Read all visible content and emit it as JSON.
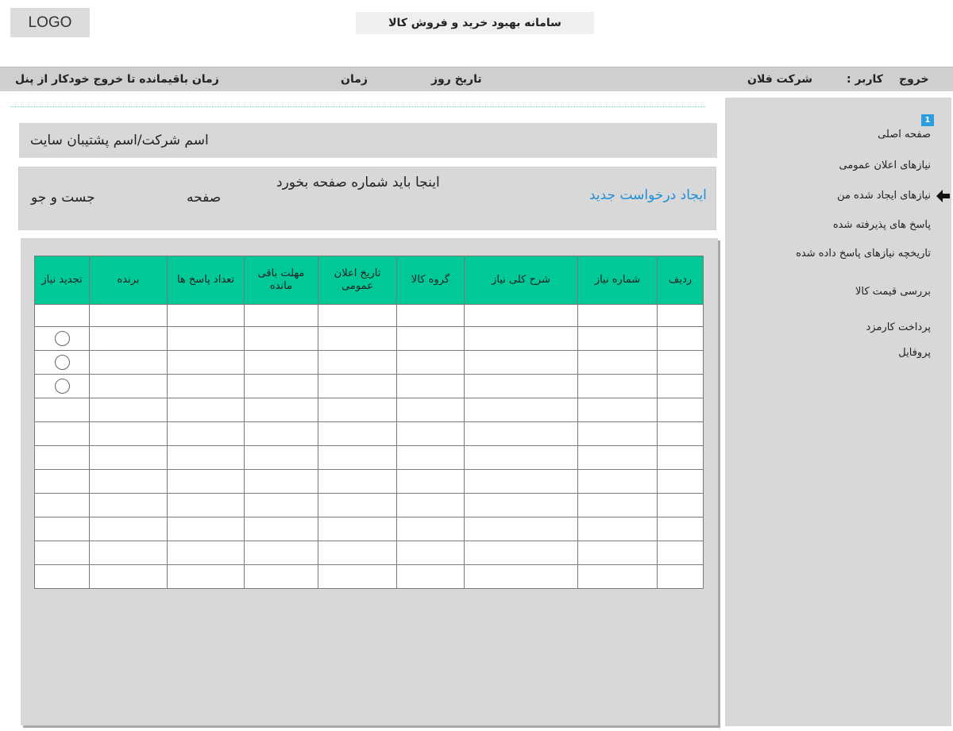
{
  "logo": "LOGO",
  "site_title": "سامانه بهبود خرید و فروش کالا",
  "topbar": {
    "logout": "خروج",
    "user_label": "کاربر :",
    "company": "شرکت فلان",
    "date": "تاریخ روز",
    "time": "زمان",
    "remaining": "زمان باقیمانده تا خروج خودکار از پنل"
  },
  "sidebar": {
    "badge": "1",
    "items": [
      "صفحه اصلی",
      "نیازهای اعلان عمومی",
      "نیازهای ایجاد شده من",
      "پاسخ های پذیرفته شده",
      "تاریخچه نیازهای پاسخ داده شده",
      "بررسی قیمت کالا",
      "پرداخت کارمزد",
      "پروفایل"
    ]
  },
  "company_name": "اسم شرکت/اسم پشتیبان سایت",
  "toolbar": {
    "new_request": "ایجاد درخواست جدید",
    "page_number_note": "اینجا باید شماره صفحه بخورد",
    "page_label": "صفحه",
    "search": "جست و جو"
  },
  "table": {
    "columns": [
      "ردیف",
      "شماره نیاز",
      "شرح کلی نیاز",
      "گروه کالا",
      "تاریخ اعلان عمومی",
      "مهلت باقی مانده",
      "تعداد پاسخ ها",
      "برنده",
      "تجدید نیاز"
    ],
    "radio_rows": [
      1,
      2,
      3
    ],
    "row_count": 12
  }
}
